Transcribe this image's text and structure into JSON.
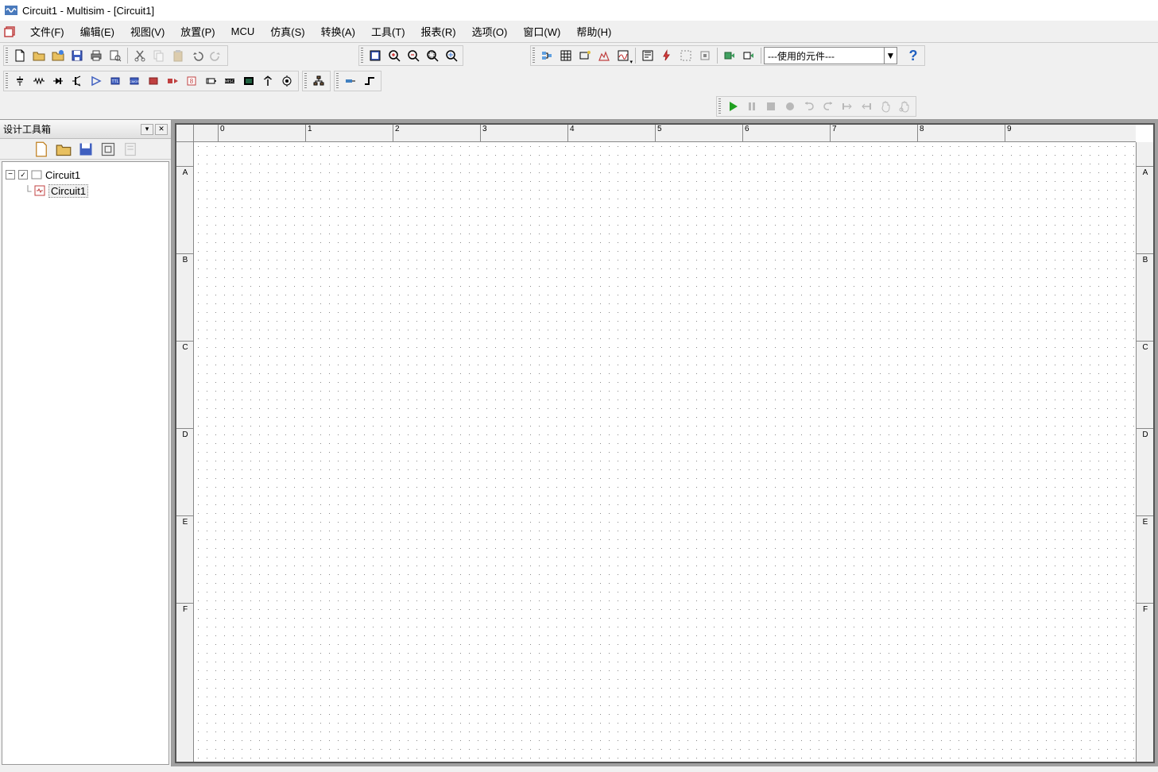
{
  "title": "Circuit1 - Multisim - [Circuit1]",
  "menus": {
    "file": "文件(F)",
    "edit": "编辑(E)",
    "view": "视图(V)",
    "place": "放置(P)",
    "mcu": "MCU",
    "simulate": "仿真(S)",
    "transfer": "转换(A)",
    "tools": "工具(T)",
    "reports": "报表(R)",
    "options": "选项(O)",
    "window": "窗口(W)",
    "help": "帮助(H)"
  },
  "combo": {
    "used_components": "---使用的元件---"
  },
  "sidebar": {
    "title": "设计工具箱",
    "tree": {
      "root": "Circuit1",
      "child": "Circuit1"
    }
  },
  "ruler_h": [
    "0",
    "1",
    "2",
    "3",
    "4",
    "5",
    "6",
    "7",
    "8",
    "9"
  ],
  "ruler_v": [
    "A",
    "B",
    "C",
    "D",
    "E",
    "F"
  ],
  "icons": {
    "new": "new-file-icon",
    "open": "open-icon",
    "open2": "open-folder-icon",
    "save": "save-icon",
    "print": "print-icon",
    "preview": "preview-icon",
    "cut": "cut-icon",
    "copy": "copy-icon",
    "paste": "paste-icon",
    "undo": "undo-icon",
    "redo": "redo-icon",
    "window": "window-icon",
    "zoomin": "zoom-in-icon",
    "zoomout": "zoom-out-icon",
    "zoomfit": "zoom-fit-icon",
    "zoomarea": "zoom-area-icon",
    "db": "database-icon",
    "grid": "grid-icon",
    "find": "find-replace-icon",
    "sheet": "sheet-icon",
    "graph": "graph-icon",
    "postproc": "postprocessor-icon",
    "prober": "probe-icon",
    "select": "select-icon",
    "netlist": "netlist-icon",
    "export": "export-icon",
    "ground": "ground-icon",
    "resistor": "resistor-icon",
    "diode": "diode-icon",
    "transistor": "transistor-icon",
    "opamp": "opamp-icon",
    "ttl": "ttl-icon",
    "cmos": "cmos-icon",
    "misc1": "misc-digital-icon",
    "mixed": "mixed-icon",
    "indicator": "indicator-icon",
    "power": "power-icon",
    "misc": "misc-icon",
    "advanced": "advanced-icon",
    "rf": "rf-icon",
    "electro": "electromech-icon",
    "hier": "hierarchical-icon",
    "bus": "bus-icon",
    "conn": "connector-icon",
    "run": "run-icon",
    "pause": "pause-icon",
    "stop": "stop-icon",
    "record": "record-icon",
    "stepinto": "step-into-icon",
    "stepover": "step-over-icon",
    "stepout": "step-out-icon",
    "stepback": "step-back-icon",
    "hand": "pan-icon",
    "select2": "pointer-icon"
  }
}
